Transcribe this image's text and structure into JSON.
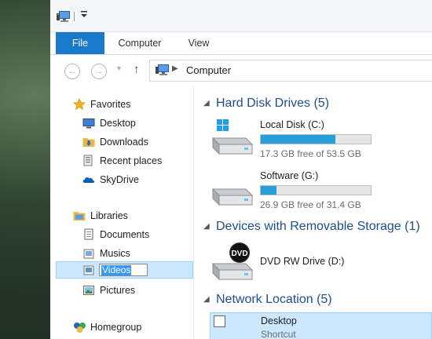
{
  "ribbon": {
    "tabs": [
      {
        "label": "File"
      },
      {
        "label": "Computer"
      },
      {
        "label": "View"
      }
    ]
  },
  "address": {
    "path": [
      "Computer"
    ]
  },
  "nav": {
    "favorites": {
      "label": "Favorites",
      "items": [
        {
          "label": "Desktop",
          "icon": "desktop-icon"
        },
        {
          "label": "Downloads",
          "icon": "downloads-folder-icon"
        },
        {
          "label": "Recent places",
          "icon": "recent-places-icon"
        },
        {
          "label": "SkyDrive",
          "icon": "skydrive-icon"
        }
      ]
    },
    "libraries": {
      "label": "Libraries",
      "items": [
        {
          "label": "Documents",
          "icon": "documents-icon"
        },
        {
          "label": "Musics",
          "icon": "music-icon"
        },
        {
          "label": "Videos",
          "icon": "videos-icon",
          "state": "renaming"
        },
        {
          "label": "Pictures",
          "icon": "pictures-icon"
        }
      ]
    },
    "homegroup": {
      "label": "Homegroup"
    }
  },
  "content": {
    "groups": {
      "hard_disks": {
        "header": "Hard Disk Drives (5)"
      },
      "removable": {
        "header": "Devices with Removable Storage (1)"
      },
      "network": {
        "header": "Network Location (5)"
      }
    },
    "drives": [
      {
        "name": "Local Disk (C:)",
        "free_text": "17.3 GB free of 53.5 GB",
        "used_fraction": 0.677
      },
      {
        "name": "Software (G:)",
        "free_text": "26.9 GB free of 31.4 GB",
        "used_fraction": 0.143
      }
    ],
    "removable_devices": [
      {
        "name": "DVD RW Drive (D:)",
        "disc_label": "DVD"
      }
    ],
    "network_items": [
      {
        "name": "Desktop",
        "subtitle": "Shortcut"
      }
    ]
  },
  "colors": {
    "accent": "#1979ca",
    "selection": "#cce8ff",
    "group_header": "#1e4e8c",
    "drive_bar": "#26a0da"
  }
}
